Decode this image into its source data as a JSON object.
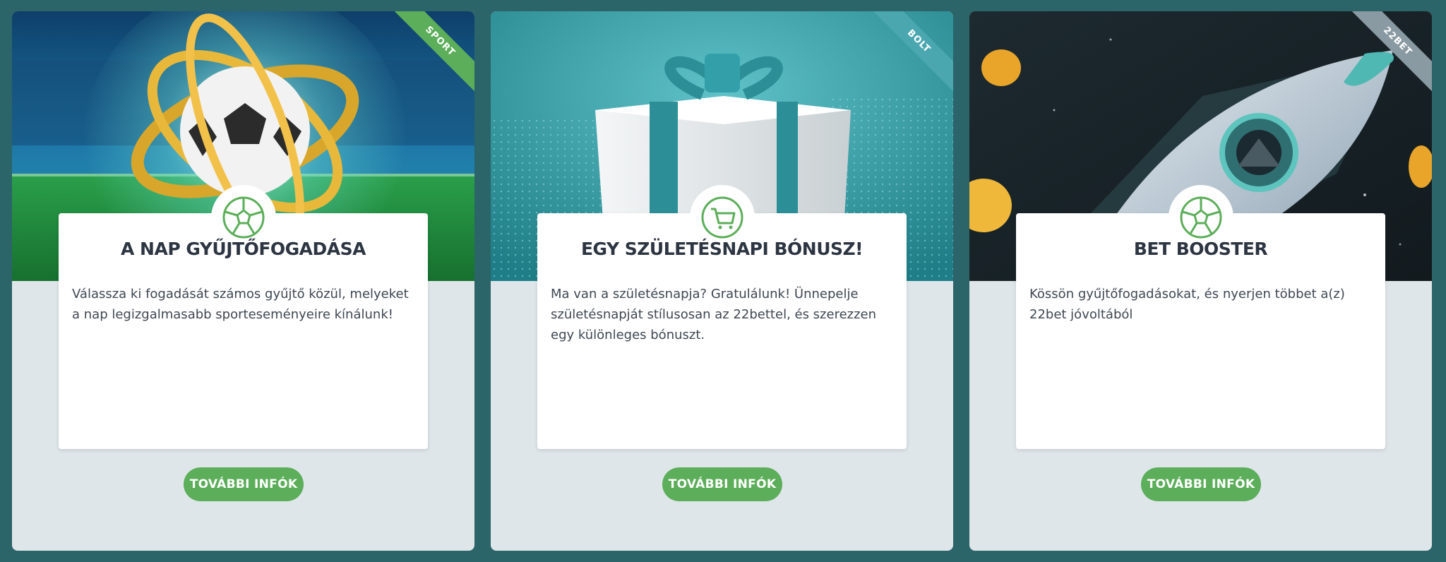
{
  "colors": {
    "background": "#2b6469",
    "card": "#dfe6ea",
    "accent": "#5cae5a",
    "title": "#2c3541"
  },
  "cards": [
    {
      "ribbon": "SPORT",
      "ribbon_color": "#5cae5a",
      "icon": "soccer-ball-icon",
      "title": "A NAP GYŰJTŐFOGADÁSA",
      "description": "Válassza ki fogadását számos gyűjtő közül, melyeket a nap legizgalmasabb sporteseményeire kínálunk!",
      "button": "TOVÁBBI INFÓK"
    },
    {
      "ribbon": "BOLT",
      "ribbon_color": "#4aa7b0",
      "icon": "shopping-cart-icon",
      "title": "EGY SZÜLETÉSNAPI BÓNUSZ!",
      "description": "Ma van a születésnapja? Gratulálunk! Ünnepelje születésnapját stílusosan az 22bettel, és szerezzen egy különleges bónuszt.",
      "button": "TOVÁBBI INFÓK"
    },
    {
      "ribbon": "22BET",
      "ribbon_color": "#8a9aa2",
      "icon": "soccer-ball-icon",
      "title": "BET BOOSTER",
      "description": "Kössön gyűjtőfogadásokat, és nyerjen többet a(z) 22bet jóvoltából",
      "button": "TOVÁBBI INFÓK"
    }
  ]
}
